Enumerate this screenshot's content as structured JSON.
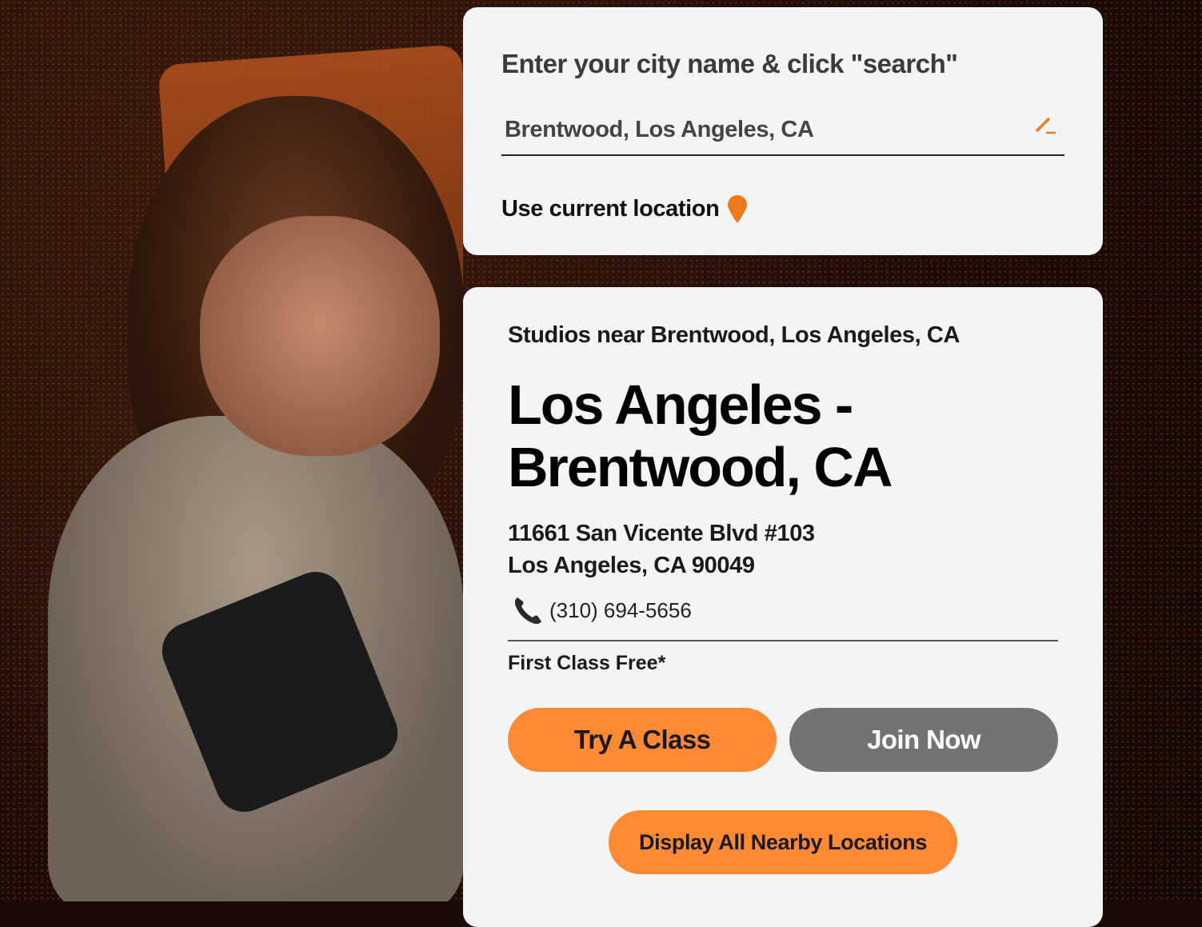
{
  "search": {
    "prompt": "Enter your city name & click \"search\"",
    "value": "Brentwood, Los Angeles, CA",
    "edit_icon": "pencil-icon",
    "use_location_label": "Use current location",
    "location_icon": "map-pin-icon"
  },
  "results": {
    "studios_near": "Studios near Brentwood, Los Angeles, CA",
    "studio_name": "Los Angeles - Brentwood, CA",
    "address_line1": "11661 San Vicente Blvd #103",
    "address_line2": "Los Angeles, CA 90049",
    "phone_icon": "telephone-icon",
    "phone": "(310) 694-5656",
    "offer": "First Class Free*",
    "try_label": "Try A Class",
    "join_label": "Join Now",
    "display_all_label": "Display All Nearby Locations"
  },
  "colors": {
    "accent": "#ff8a33",
    "secondary_button": "#737373",
    "card_bg": "#f3f4f6",
    "pin": "#f07a1a"
  }
}
